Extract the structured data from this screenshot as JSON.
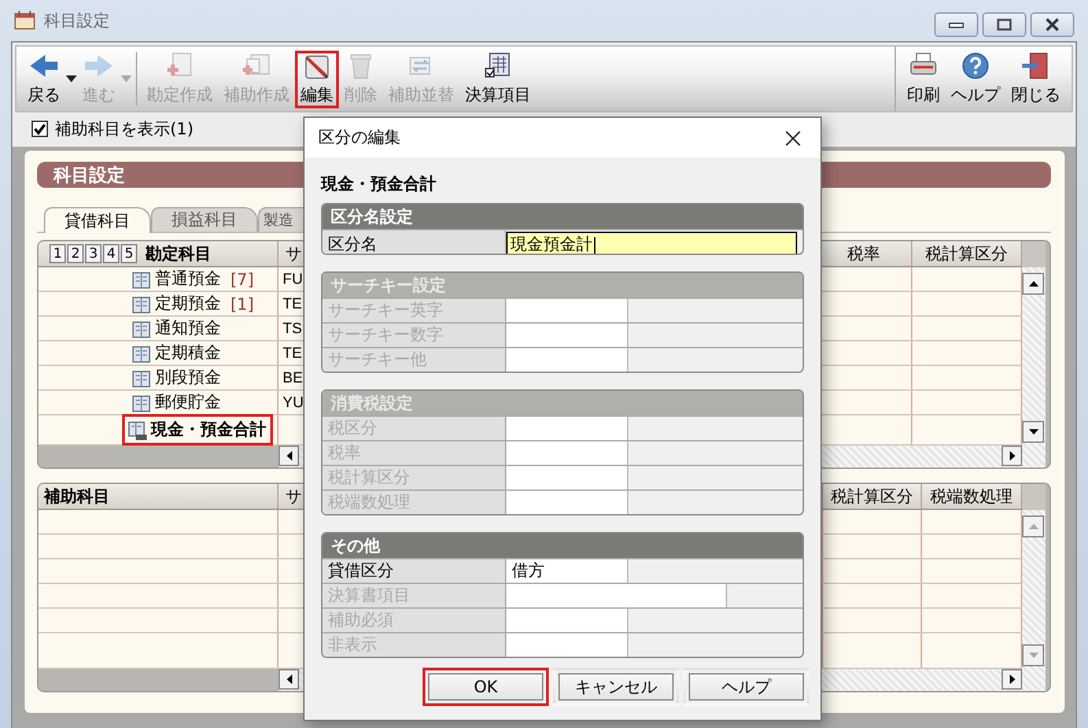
{
  "window": {
    "title": "科目設定"
  },
  "toolbar": {
    "left": [
      {
        "kind": "back",
        "label": "戻る",
        "disabled": false,
        "dropdown": true,
        "highlighted": false
      },
      {
        "kind": "forward",
        "label": "進む",
        "disabled": true,
        "dropdown": true,
        "highlighted": false
      },
      {
        "kind": "create",
        "label": "勘定作成",
        "disabled": true,
        "dropdown": false,
        "highlighted": false
      },
      {
        "kind": "create-sub",
        "label": "補助作成",
        "disabled": true,
        "dropdown": false,
        "highlighted": false
      },
      {
        "kind": "edit",
        "label": "編集",
        "disabled": false,
        "dropdown": false,
        "highlighted": true
      },
      {
        "kind": "delete",
        "label": "削除",
        "disabled": true,
        "dropdown": false,
        "highlighted": false
      },
      {
        "kind": "sort",
        "label": "補助並替",
        "disabled": true,
        "dropdown": false,
        "highlighted": false
      },
      {
        "kind": "settlement",
        "label": "決算項目",
        "disabled": false,
        "dropdown": false,
        "highlighted": false
      }
    ],
    "right": [
      {
        "kind": "print",
        "label": "印刷",
        "disabled": false,
        "dropdown": false,
        "highlighted": false
      },
      {
        "kind": "help",
        "label": "ヘルプ",
        "disabled": false,
        "dropdown": false,
        "highlighted": false
      },
      {
        "kind": "exit",
        "label": "閉じる",
        "disabled": false,
        "dropdown": false,
        "highlighted": false
      }
    ]
  },
  "show_sub_accounts": {
    "label": "補助科目を表示(1)",
    "checked": true
  },
  "panel": {
    "title": "科目設定",
    "tabs": [
      {
        "label": "貸借科目",
        "selected": true
      },
      {
        "label": "損益科目",
        "selected": false
      },
      {
        "label": "製造",
        "selected": false
      }
    ]
  },
  "accounts_table": {
    "level_buttons": [
      "1",
      "2",
      "3",
      "4",
      "5"
    ],
    "columns": [
      "勘定科目",
      "サ",
      "税率",
      "税計算区分"
    ],
    "rows": [
      {
        "kind": "account",
        "name": "普通預金",
        "count": "[7]",
        "code": "FU",
        "highlighted": false
      },
      {
        "kind": "account",
        "name": "定期預金",
        "count": "[1]",
        "code": "TE",
        "highlighted": false
      },
      {
        "kind": "account",
        "name": "通知預金",
        "code": "TS",
        "highlighted": false
      },
      {
        "kind": "account",
        "name": "定期積金",
        "code": "TE",
        "highlighted": false
      },
      {
        "kind": "account",
        "name": "別段預金",
        "code": "BE",
        "highlighted": false
      },
      {
        "kind": "account",
        "name": "郵便貯金",
        "code": "YU",
        "highlighted": false
      },
      {
        "kind": "total",
        "name": "現金・預金合計",
        "highlighted": true
      }
    ]
  },
  "sub_table": {
    "columns": [
      "補助科目",
      "サ",
      "税計算区分",
      "税端数処理"
    ]
  },
  "dialog": {
    "title": "区分の編集",
    "heading": "現金・預金合計",
    "groups": [
      {
        "title": "区分名設定",
        "disabled": false,
        "rows": [
          {
            "kind": "input",
            "label": "区分名",
            "value": "現金預金計",
            "disabled": false
          }
        ]
      },
      {
        "title": "サーチキー設定",
        "disabled": true,
        "rows": [
          {
            "kind": "field",
            "label": "サーチキー英字",
            "disabled": true
          },
          {
            "kind": "field",
            "label": "サーチキー数字",
            "disabled": true
          },
          {
            "kind": "field",
            "label": "サーチキー他",
            "disabled": true
          }
        ]
      },
      {
        "title": "消費税設定",
        "disabled": true,
        "rows": [
          {
            "kind": "field",
            "label": "税区分",
            "disabled": true
          },
          {
            "kind": "field",
            "label": "税率",
            "disabled": true
          },
          {
            "kind": "field",
            "label": "税計算区分",
            "disabled": true
          },
          {
            "kind": "field",
            "label": "税端数処理",
            "disabled": true
          }
        ]
      },
      {
        "title": "その他",
        "disabled": false,
        "rows": [
          {
            "kind": "short",
            "label": "貸借区分",
            "value": "借方",
            "disabled": false
          },
          {
            "kind": "wide",
            "label": "決算書項目",
            "disabled": true
          },
          {
            "kind": "short",
            "label": "補助必須",
            "disabled": true
          },
          {
            "kind": "short",
            "label": "非表示",
            "disabled": true
          }
        ]
      }
    ],
    "buttons": [
      {
        "label": "OK",
        "highlighted": true
      },
      {
        "label": "キャンセル",
        "highlighted": false
      },
      {
        "label": "ヘルプ",
        "highlighted": false
      }
    ]
  }
}
